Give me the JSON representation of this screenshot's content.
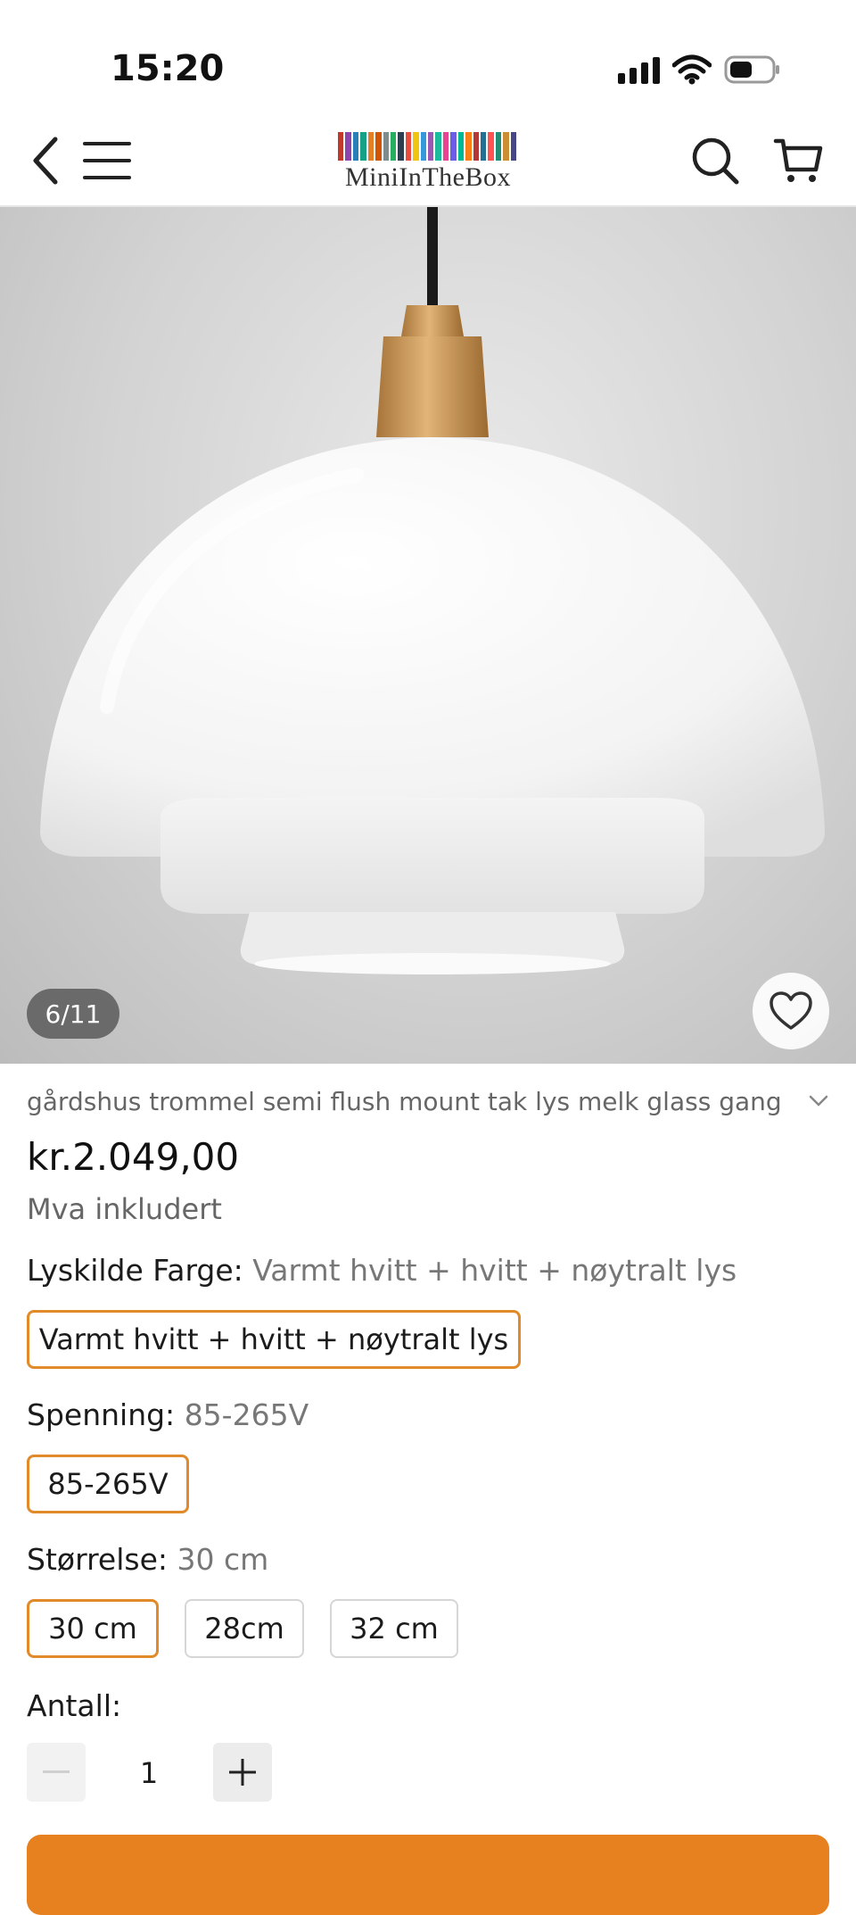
{
  "status_bar": {
    "time": "15:20"
  },
  "header": {
    "logo_text": "MiniInTheBox"
  },
  "gallery": {
    "counter": "6/11"
  },
  "product": {
    "title": "gårdshus trommel semi flush mount tak lys melk glass gang",
    "price": "kr.2.049,00",
    "vat_note": "Mva inkludert"
  },
  "options": {
    "light_color": {
      "label": "Lyskilde Farge:",
      "selected": "Varmt hvitt + hvitt + nøytralt lys",
      "choices": [
        "Varmt hvitt + hvitt + nøytralt lys"
      ]
    },
    "voltage": {
      "label": "Spenning:",
      "selected": "85-265V",
      "choices": [
        "85-265V"
      ]
    },
    "size": {
      "label": "Størrelse:",
      "selected": "30 cm",
      "choices": [
        "30 cm",
        "28cm",
        "32 cm"
      ]
    }
  },
  "quantity": {
    "label": "Antall:",
    "value": "1"
  },
  "colors": {
    "accent": "#e08a2a",
    "cta": "#e7801f"
  }
}
